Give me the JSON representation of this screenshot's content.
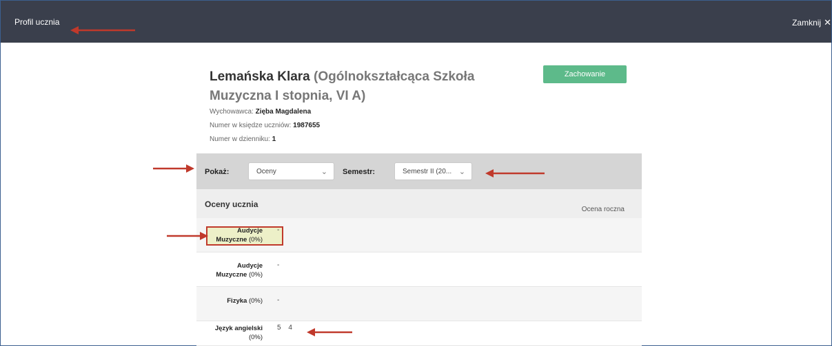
{
  "window": {
    "title": "Profil ucznia",
    "close_label": "Zamknij"
  },
  "student": {
    "name": "Lemańska Klara",
    "school": "(Ogólnokształcąca Szkoła Muzyczna I stopnia, VI A)"
  },
  "actions": {
    "behavior_button": "Zachowanie"
  },
  "info": [
    {
      "label": "Wychowawca:",
      "value": "Zięba Magdalena"
    },
    {
      "label": "Numer w księdze uczniów:",
      "value": "1987655"
    },
    {
      "label": "Numer w dzienniku:",
      "value": "1"
    }
  ],
  "filters": {
    "show_label": "Pokaż:",
    "show_value": "Oceny",
    "semester_label": "Semestr:",
    "semester_value": "Semestr II (20..."
  },
  "grades_section": {
    "title": "Oceny ucznia",
    "annual_label": "Ocena roczna",
    "rows": [
      {
        "subject_bold": "Audycje Muzyczne",
        "subject_pct": "(0%)",
        "grades": [
          "-"
        ]
      },
      {
        "subject_bold": "Audycje Muzyczne",
        "subject_pct": "(0%)",
        "grades": [
          "-"
        ]
      },
      {
        "subject_bold": "Fizyka",
        "subject_pct": "(0%)",
        "grades": [
          "-"
        ]
      },
      {
        "subject_bold": "Język angielski",
        "subject_pct": "(0%)",
        "grades": [
          "5",
          "4"
        ]
      }
    ]
  },
  "colors": {
    "topbar": "#3a3f4c",
    "accent_green": "#5dba8a",
    "annotation_red": "#c0392b",
    "highlight_bg": "#edf0c8"
  }
}
